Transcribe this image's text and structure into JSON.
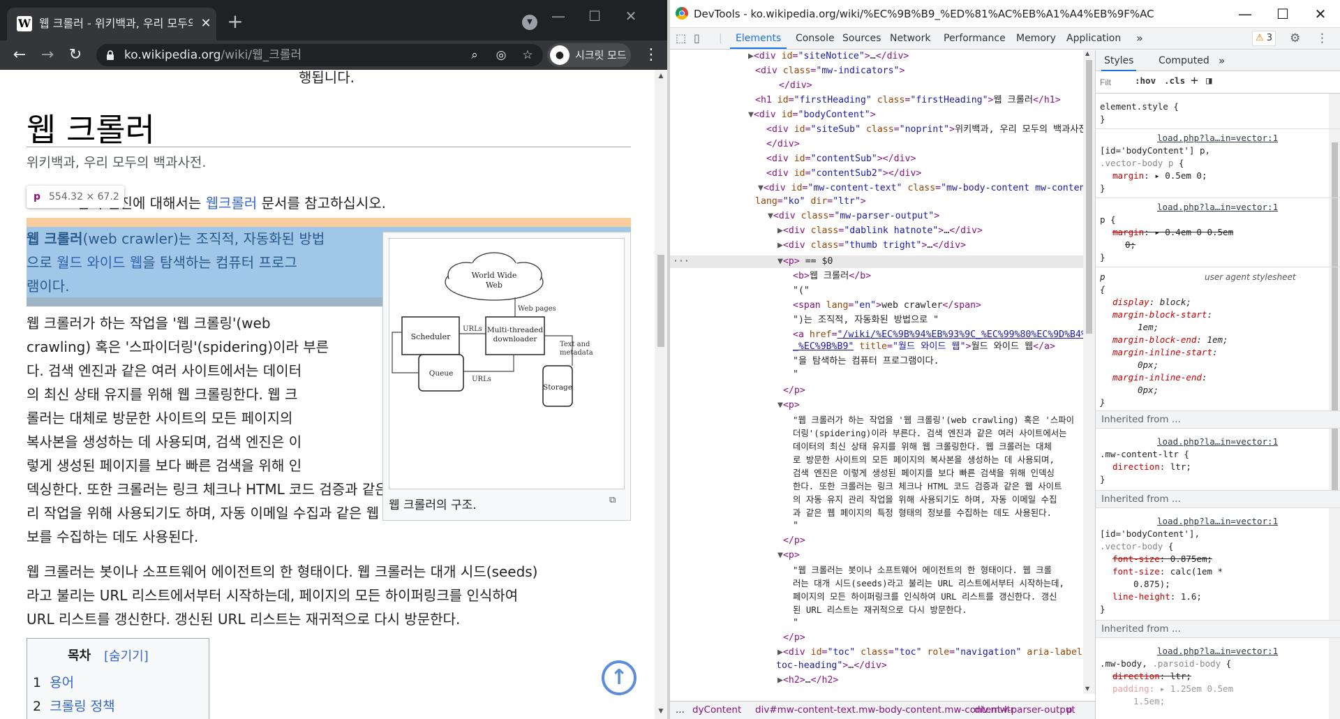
{
  "browser": {
    "tab_title": "웹 크롤러 - 위키백과, 우리 모두의 백과사전",
    "tab_icon_letter": "W",
    "url_host": "ko.wikipedia.org",
    "url_path": "/wiki/웹_크롤러",
    "incognito_label": "시크릿 모드"
  },
  "article": {
    "cut_top": "행됩니다.",
    "title": "웹 크롤러",
    "subtitle": "위키백과, 우리 모두의 백과사전.",
    "hatnote_pre": "검색 엔진에 대해서는",
    "hatnote_link": "웹크롤러",
    "hatnote_post": "문서를 참고하십시오.",
    "tooltip_tag": "p",
    "tooltip_size": "554.32 × 67.2",
    "p1_bold": "웹 크롤러",
    "p1_l1": "(web crawler)는 조직적, 자동화된 방법",
    "p1_l2_pre": "으로 ",
    "p1_l2_link": "월드 와이드 웹",
    "p1_l2_post": "을 탐색하는 컴퓨터 프로그",
    "p1_l3": "램이다.",
    "p2_lines": [
      "웹 크롤러가 하는 작업을 '웹 크롤링'(web",
      "crawling) 혹은 '스파이더링'(spidering)이라 부른",
      "다. 검색 엔진과 같은 여러 사이트에서는 데이터",
      "의 최신 상태 유지를 위해 웹 크롤링한다. 웹 크",
      "롤러는 대체로 방문한 사이트의 모든 페이지의",
      "복사본을 생성하는 데 사용되며, 검색 엔진은 이",
      "렇게 생성된 페이지를 보다 빠른 검색을 위해 인",
      "덱싱한다. 또한 크롤러는 링크 체크나 HTML 코드 검증과 같은 웹 사이트의 자동 유지 관",
      "리 작업을 위해 사용되기도 하며, 자동 이메일 수집과 같은 웹 페이지의 특정 형태의 정",
      "보를 수집하는 데도 사용된다."
    ],
    "p3_lines": [
      "웹 크롤러는 봇이나 소프트웨어 에이전트의 한 형태이다. 웹 크롤러는 대개 시드(seeds)",
      "라고 불리는 URL 리스트에서부터 시작하는데, 페이지의 모든 하이퍼링크를 인식하여",
      "URL 리스트를 갱신한다. 갱신된 URL 리스트는 재귀적으로 다시 방문한다."
    ],
    "figure": {
      "cloud": "World Wide",
      "cloud2": "Web",
      "web_pages": "Web pages",
      "scheduler": "Scheduler",
      "urls1": "URLs",
      "mtd1": "Multi-threaded",
      "mtd2": "downloader",
      "text1": "Text and",
      "text2": "metadata",
      "queue": "Queue",
      "urls2": "URLs",
      "storage": "Storage",
      "caption": "웹 크롤러의 구조."
    },
    "toc": {
      "title": "목차",
      "hide": "[숨기기]",
      "items": [
        {
          "num": "1",
          "label": "용어"
        },
        {
          "num": "2",
          "label": "크롤링 정책"
        }
      ]
    }
  },
  "devtools": {
    "window_title": "DevTools - ko.wikipedia.org/wiki/%EC%9B%B9_%ED%81%AC%EB%A1%A4%EB%9F%AC",
    "tabs": [
      "Elements",
      "Console",
      "Sources",
      "Network",
      "Performance",
      "Memory",
      "Application"
    ],
    "more_tabs": "»",
    "warnings": "3",
    "breadcrumbs": [
      "...",
      "dyContent",
      "div#mw-content-text.mw-body-content.mw-content-ltr",
      "div.mw-parser-output",
      "p"
    ],
    "styles_tabs": [
      "Styles",
      "Computed"
    ],
    "filter_placeholder": "Filt",
    "hov": ":hov",
    "cls": ".cls",
    "inherited_label": "Inherited from ..."
  }
}
